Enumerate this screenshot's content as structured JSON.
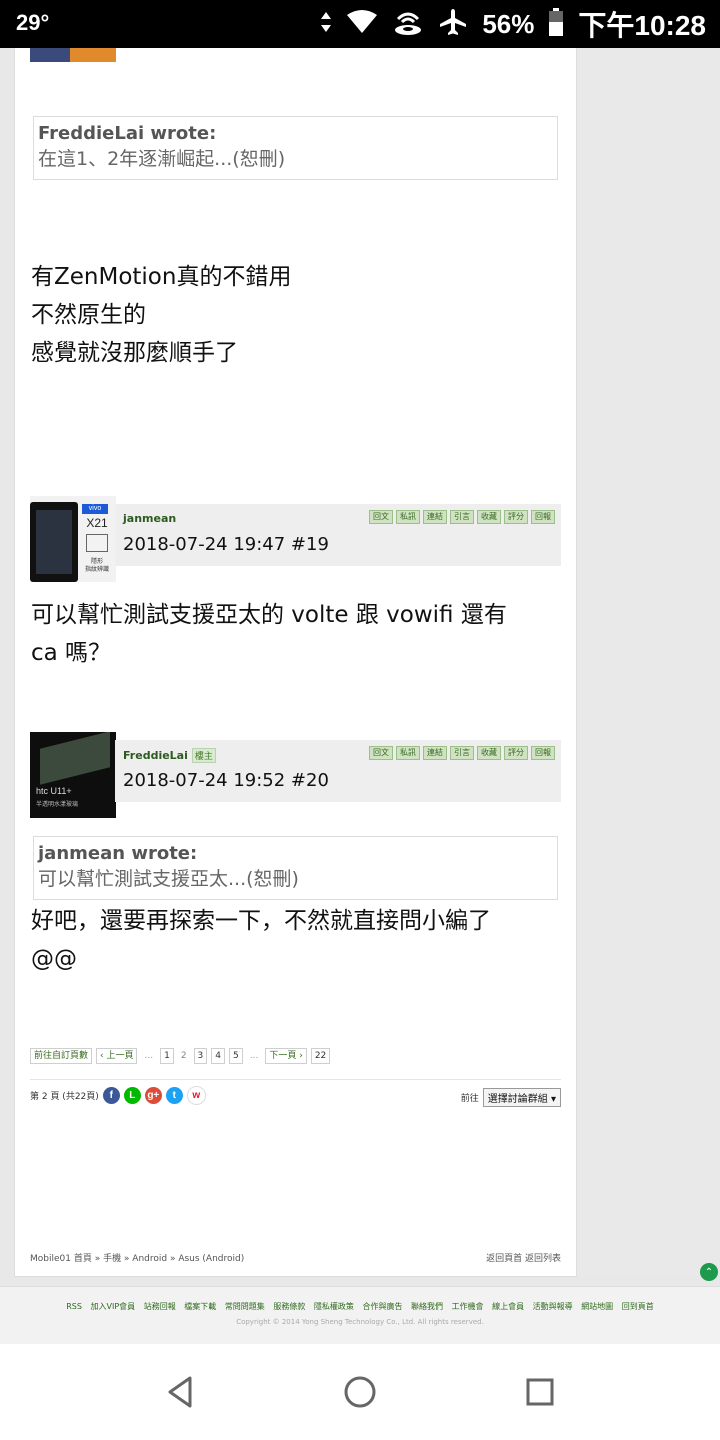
{
  "status_bar": {
    "temperature": "29°",
    "battery_percent": "56%",
    "time": "下午10:28"
  },
  "quote1": {
    "author": "FreddieLai wrote:",
    "text": "在這1、2年逐漸崛起...(恕刪)"
  },
  "post18_body": [
    "有ZenMotion真的不錯用",
    "不然原生的",
    "感覺就沒那麼順手了"
  ],
  "post19": {
    "username": "janmean",
    "datetime": "2018-07-24 19:47  #19",
    "avatar": {
      "brand": "vivo",
      "model": "X21",
      "caption1": "隱形",
      "caption2": "指紋辨識"
    },
    "body": [
      "可以幫忙測試支援亞太的 volte 跟 vowifi 還有",
      "ca 嗎？"
    ]
  },
  "post20": {
    "username": "FreddieLai",
    "badge": "樓主",
    "datetime": "2018-07-24 19:52  #20",
    "avatar": {
      "model": "htc U11+",
      "caption": "半透明水漾玻璃"
    },
    "quote": {
      "author": "janmean wrote:",
      "text": "可以幫忙測試支援亞太...(恕刪)"
    },
    "body": [
      "好吧，還要再探索一下，不然就直接問小編了",
      "@@"
    ]
  },
  "post_actions": [
    "回文",
    "私訊",
    "連結",
    "引言",
    "收藏",
    "評分",
    "回報"
  ],
  "pager": {
    "goto_page": "前往自訂頁數",
    "prev": "‹ 上一頁",
    "ellipsis": "...",
    "pages": [
      "1",
      "2",
      "3",
      "4",
      "5"
    ],
    "current": "2",
    "next": "下一頁 ›",
    "last": "22"
  },
  "page_info": "第 2 頁 (共22頁)",
  "social_icons": [
    "facebook-icon",
    "line-icon",
    "google-plus-icon",
    "twitter-icon",
    "weibo-icon"
  ],
  "goto_label": "前往",
  "group_select": "選擇討論群組",
  "breadcrumb": "Mobile01 首頁 » 手機 » Android » Asus (Android)",
  "back_links": {
    "home": "返回頁首",
    "list": "返回列表"
  },
  "footer": {
    "links": [
      "RSS",
      "加入VIP會員",
      "站務回報",
      "檔案下載",
      "常問問題集",
      "服務條款",
      "隱私權政策",
      "合作與廣告",
      "聯絡我們",
      "工作機會",
      "線上會員",
      "活動與報導",
      "網站地圖",
      "回到頁首"
    ],
    "copyright": "Copyright © 2014 Yong Sheng Technology Co., Ltd. All rights reserved."
  },
  "colors": {
    "accent_green": "#2f6b1c",
    "action_green": "#cfe2c2",
    "scroll_top": "#1d9a4b"
  }
}
